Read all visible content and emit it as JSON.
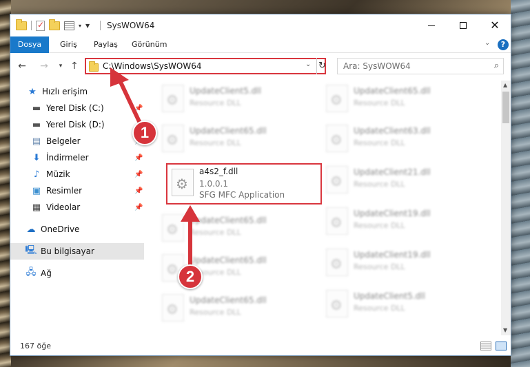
{
  "window": {
    "title": "SysWOW64",
    "controls": {
      "minimize": "—",
      "maximize": "☐",
      "close": "✕"
    }
  },
  "ribbon": {
    "tabs": [
      "Dosya",
      "Giriş",
      "Paylaş",
      "Görünüm"
    ],
    "active_tab": "Dosya",
    "accent_color": "#1979ca",
    "help": "?"
  },
  "address": {
    "path": "C:\\Windows\\SysWOW64",
    "search_placeholder": "Ara: SysWOW64"
  },
  "nav": {
    "items": [
      {
        "label": "Hızlı erişim",
        "icon": "star-icon",
        "pinned": false
      },
      {
        "label": "Yerel Disk (C:)",
        "icon": "drive-icon",
        "pinned": true
      },
      {
        "label": "Yerel Disk (D:)",
        "icon": "drive-icon",
        "pinned": false
      },
      {
        "label": "Belgeler",
        "icon": "documents-icon",
        "pinned": true
      },
      {
        "label": "İndirmeler",
        "icon": "downloads-icon",
        "pinned": true
      },
      {
        "label": "Müzik",
        "icon": "music-icon",
        "pinned": true
      },
      {
        "label": "Resimler",
        "icon": "pictures-icon",
        "pinned": true
      },
      {
        "label": "Videolar",
        "icon": "videos-icon",
        "pinned": true
      },
      {
        "label": "OneDrive",
        "icon": "cloud-icon",
        "pinned": false
      },
      {
        "label": "Bu bilgisayar",
        "icon": "computer-icon",
        "pinned": false,
        "selected": true
      },
      {
        "label": "Ağ",
        "icon": "network-icon",
        "pinned": false
      }
    ]
  },
  "files": {
    "left_column": [
      {
        "name": "UpdateClient5.dll",
        "type": "Resource DLL"
      },
      {
        "name": "UpdateClient65.dll",
        "type": "Resource DLL"
      },
      {
        "name": "UpdateClient65.dll",
        "type": "Resource DLL"
      },
      {
        "name": "UpdateClient65.dll",
        "type": "Resource DLL"
      },
      {
        "name": "UpdateClient65.dll",
        "type": "Resource DLL"
      }
    ],
    "right_column": [
      {
        "name": "UpdateClient65.dll",
        "type": "Resource DLL"
      },
      {
        "name": "UpdateClient63.dll",
        "type": "Resource DLL"
      },
      {
        "name": "UpdateClient21.dll",
        "type": "Resource DLL"
      },
      {
        "name": "UpdateClient19.dll",
        "type": "Resource DLL"
      },
      {
        "name": "UpdateClient19.dll",
        "type": "Resource DLL"
      },
      {
        "name": "UpdateClient5.dll",
        "type": "Resource DLL"
      }
    ],
    "highlighted": {
      "name": "a4s2_f.dll",
      "version": "1.0.0.1",
      "description": "SFG MFC Application"
    }
  },
  "status": {
    "item_count": "167 öğe"
  },
  "annotations": {
    "step1": "1",
    "step2": "2",
    "color": "#d6343b"
  }
}
